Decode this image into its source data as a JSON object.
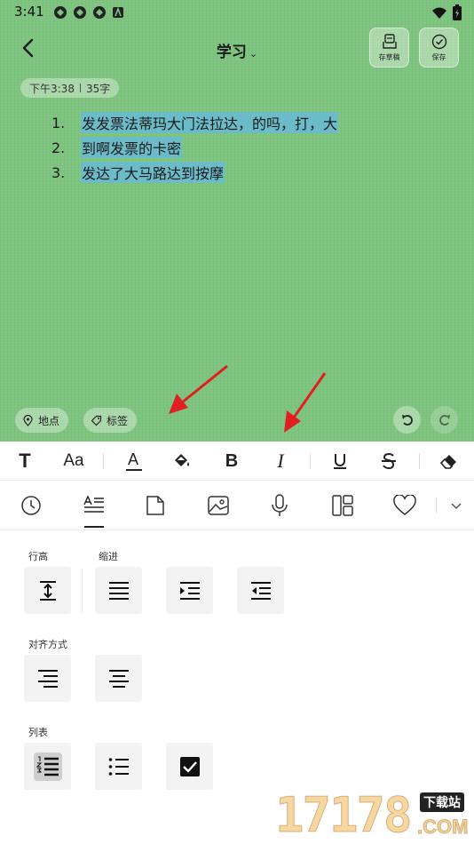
{
  "status_bar": {
    "time": "3:41"
  },
  "header": {
    "title": "学习",
    "draft_label": "存草稿",
    "save_label": "保存"
  },
  "meta": {
    "time": "下午3:38",
    "count": "35字"
  },
  "content": {
    "list_items": [
      {
        "number": "1.",
        "text": "发发票法蒂玛大门法拉达，的吗，打，大"
      },
      {
        "number": "2.",
        "text": " 到啊发票的卡密"
      },
      {
        "number": "3.",
        "text": " 发达了大马路达到按摩"
      }
    ]
  },
  "bottom_actions": {
    "location_label": "地点",
    "tag_label": "标签"
  },
  "format_toolbar": {
    "text_style": "T",
    "font_size": "Aa",
    "font_color": "A",
    "bold": "B",
    "italic": "I"
  },
  "panel": {
    "line_height_label": "行高",
    "indent_label": "缩进",
    "align_label": "对齐方式",
    "list_label": "列表"
  },
  "watermark": {
    "numbers": "17178",
    "site": "下载站",
    "domain": ".COM"
  },
  "colors": {
    "editor_bg": "#7ec47f",
    "highlight": "#6bbbc8",
    "arrow": "#e02020"
  }
}
